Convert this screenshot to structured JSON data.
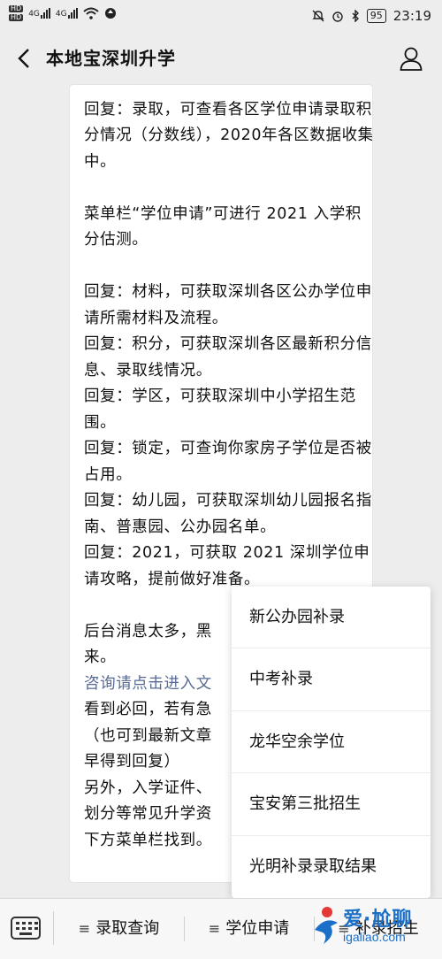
{
  "status": {
    "network": "4G",
    "network2": "4G",
    "hd1": "HD",
    "hd2": "HD",
    "battery": "95",
    "time": "23:19"
  },
  "header": {
    "title": "本地宝深圳升学"
  },
  "message": {
    "lines": [
      "回复：录取，可查看各区学位申请录取积分情况（分数线），2020年各区数据收集中。",
      "",
      "菜单栏“学位申请”可进行 2021 入学积分估测。",
      "",
      "回复：材料，可获取深圳各区公办学位申请所需材料及流程。",
      "回复：积分，可获取深圳各区最新积分信息、录取线情况。",
      "回复：学区，可获取深圳中小学招生范围。",
      "回复：锁定，可查询你家房子学位是否被占用。",
      "回复：幼儿园，可获取深圳幼儿园报名指南、普惠园、公办园名单。",
      "回复：2021，可获取 2021 深圳学位申请攻略，提前做好准备。",
      "",
      "后台消息太多，黑"
    ],
    "line_tail": "来。",
    "link": "咨询请点击进入文",
    "after": [
      "看到必回，若有急",
      "（也可到最新文章",
      "早得到回复）",
      "另外，入学证件、",
      "划分等常见升学资",
      "下方菜单栏找到。"
    ]
  },
  "popup": {
    "items": [
      "新公办园补录",
      "中考补录",
      "龙华空余学位",
      "宝安第三批招生",
      "光明补录录取结果"
    ]
  },
  "menu": {
    "icon": "≡",
    "items": [
      "录取查询",
      "学位申请",
      "补录招生"
    ]
  },
  "watermark": {
    "text": "爱·尬聊",
    "url": "igaliao.com"
  }
}
